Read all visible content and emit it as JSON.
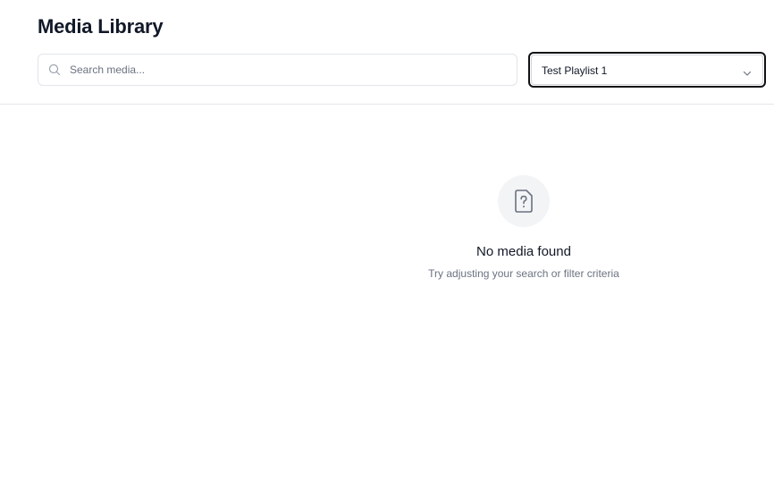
{
  "header": {
    "title": "Media Library"
  },
  "search": {
    "placeholder": "Search media...",
    "value": "",
    "icon": "search-icon"
  },
  "playlist_select": {
    "selected": "Test Playlist 1",
    "icon": "chevron-down-icon"
  },
  "empty_state": {
    "icon": "file-question-icon",
    "title": "No media found",
    "subtitle": "Try adjusting your search or filter criteria"
  },
  "colors": {
    "text_primary": "#111827",
    "text_secondary": "#6b7280",
    "border": "#e5e7eb",
    "icon_bg": "#f3f4f6",
    "focus_ring": "#111111"
  }
}
